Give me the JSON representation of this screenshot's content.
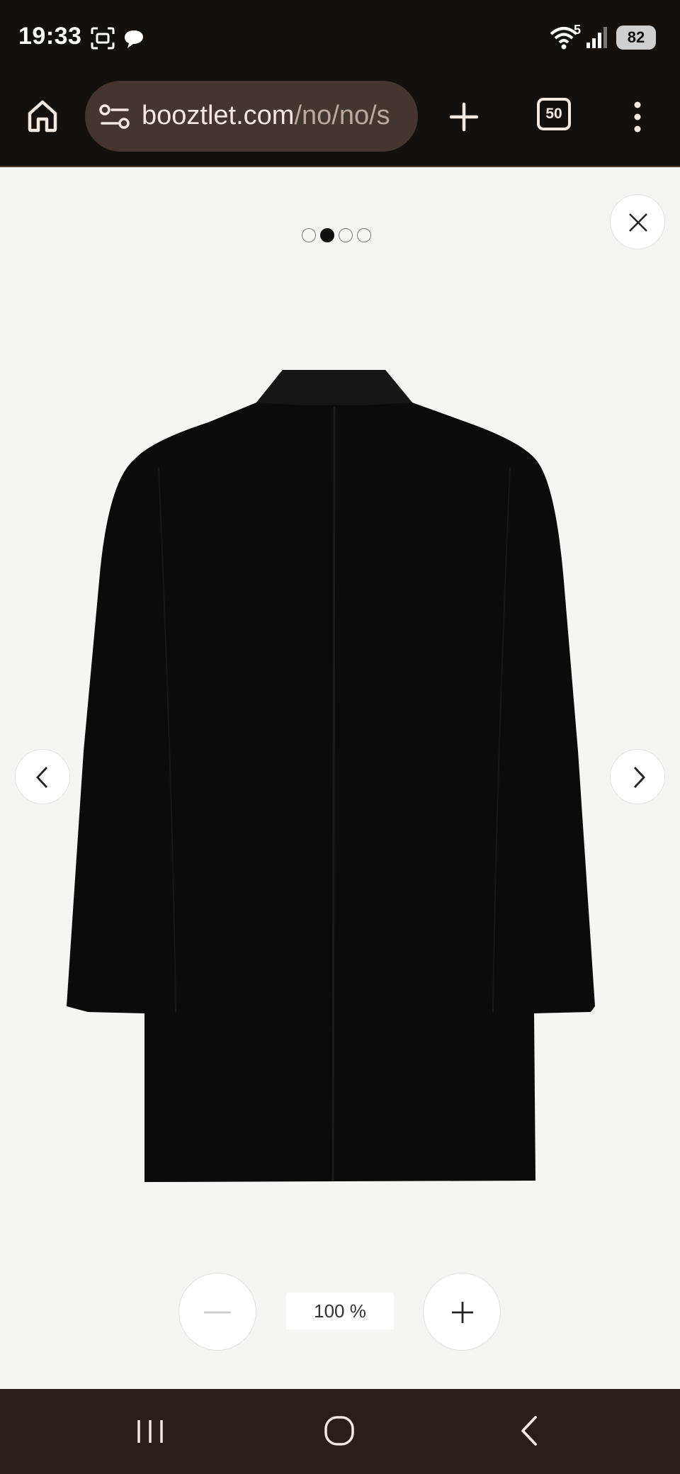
{
  "status_bar": {
    "time": "19:33",
    "signal_label": "5",
    "battery": "82",
    "icons": [
      "screenshot-icon",
      "chat-icon",
      "wifi-icon",
      "signal-icon",
      "battery-icon"
    ]
  },
  "browser": {
    "url_host": "booztlet.com",
    "url_path": "/no/no/s",
    "tab_count": "50",
    "icons": [
      "home-icon",
      "site-settings-icon",
      "new-tab-icon",
      "more-icon"
    ]
  },
  "viewer": {
    "pagination": {
      "total": 4,
      "active_index": 1
    },
    "image_icon": "coat-back-image",
    "zoom_label": "100 %",
    "icons": [
      "close-icon",
      "chevron-left-icon",
      "chevron-right-icon",
      "minus-icon",
      "plus-icon"
    ]
  },
  "system_nav": {
    "icons": [
      "recent-apps-icon",
      "home-circle-icon",
      "back-icon"
    ]
  },
  "colors": {
    "chrome_bg": "#14100d",
    "url_pill": "#433530",
    "viewer_bg": "#f5f5f4",
    "nav_bg": "#2a1e1a",
    "coat": "#0b0b0b"
  }
}
